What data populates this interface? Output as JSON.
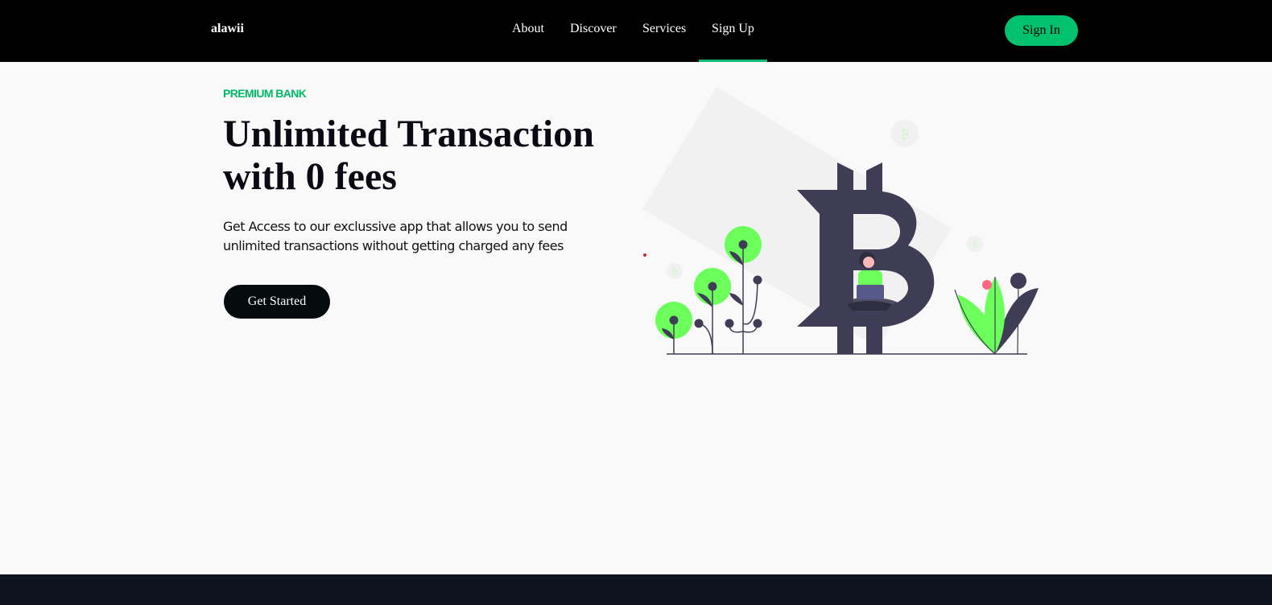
{
  "nav": {
    "logo": "alawii",
    "links": [
      {
        "label": "About",
        "active": false
      },
      {
        "label": "Discover",
        "active": false
      },
      {
        "label": "Services",
        "active": false
      },
      {
        "label": "Sign Up",
        "active": true
      }
    ],
    "signin_label": "Sign In"
  },
  "hero": {
    "eyebrow": "PREMIUM BANK",
    "headline_line1": "Unlimited Transaction",
    "headline_line2": "with 0 fees",
    "description": "Get Access to our exclussive app that allows you to send unlimited transactions without getting charged any fees",
    "cta_label": "Get Started",
    "coin_symbol": "₿"
  },
  "colors": {
    "accent": "#00c16e",
    "dark": "#050a0c",
    "bitcoin_glyph": "#3f3d56",
    "plant_green": "#6cff5c"
  }
}
